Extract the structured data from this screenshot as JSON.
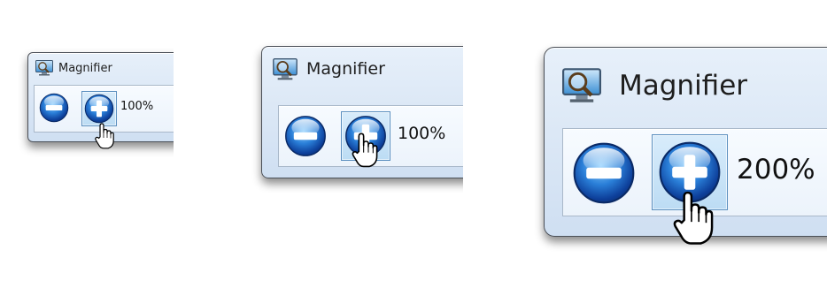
{
  "colors": {
    "button_blue": "#1d5fb8",
    "button_hover_border": "#5b8fbf",
    "window_bg": "#dce8f6"
  },
  "frames": [
    {
      "title": "Magnifier",
      "zoom_label": "100%",
      "icons": [
        "magnifier-app-icon",
        "zoom-out-icon",
        "zoom-in-icon",
        "hand-pointer-cursor-icon"
      ]
    },
    {
      "title": "Magnifier",
      "zoom_label": "100%",
      "icons": [
        "magnifier-app-icon",
        "zoom-out-icon",
        "zoom-in-icon",
        "hand-pointer-cursor-icon"
      ]
    },
    {
      "title": "Magnifier",
      "zoom_label": "200%",
      "icons": [
        "magnifier-app-icon",
        "zoom-out-icon",
        "zoom-in-icon",
        "hand-pointer-cursor-icon"
      ]
    }
  ]
}
